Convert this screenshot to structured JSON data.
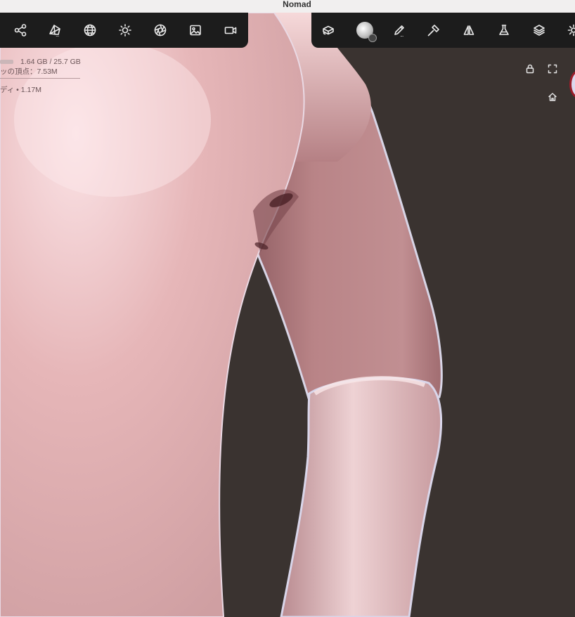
{
  "window": {
    "title": "Nomad"
  },
  "toolbar_left": {
    "tools": [
      {
        "icon": "scene-graph-icon",
        "label": "Scene"
      },
      {
        "icon": "gem-icon",
        "label": "Material"
      },
      {
        "icon": "wireframe-sphere-icon",
        "label": "Topology"
      },
      {
        "icon": "sun-icon",
        "label": "Light"
      },
      {
        "icon": "aperture-icon",
        "label": "Postprocess"
      },
      {
        "icon": "image-icon",
        "label": "Background"
      },
      {
        "icon": "video-camera-icon",
        "label": "Camera"
      }
    ],
    "overflow_marker": "..."
  },
  "toolbar_right": {
    "tools": [
      {
        "icon": "cube-interaction-icon",
        "label": "Interaction"
      },
      {
        "icon": "brush-alpha-icon",
        "label": "Stroke"
      },
      {
        "icon": "pen-icon",
        "label": "Tool"
      },
      {
        "icon": "paint-brush-icon",
        "label": "Paint"
      },
      {
        "icon": "symmetry-icon",
        "label": "Symmetry"
      },
      {
        "icon": "flask-icon",
        "label": "Experimental"
      },
      {
        "icon": "layers-icon",
        "label": "Layers"
      },
      {
        "icon": "gear-icon",
        "label": "Settings"
      }
    ],
    "overflow_marker": "..."
  },
  "stats": {
    "memory": "1.64 GB / 25.7 GB",
    "vertices": "ッの頂点：7.53M",
    "mesh": "ディ • 1.17M"
  },
  "viewport_buttons": {
    "lock": "lock-icon",
    "fullscreen": "fullscreen-icon",
    "home": "home-icon"
  },
  "colors": {
    "background": "#3a3330",
    "skin_light": "#f1c8c8",
    "skin_mid": "#c99295",
    "skin_dark": "#8d5b60",
    "toolbar": "#1c1c1c",
    "swatch_ring": "#9b1e2a"
  }
}
